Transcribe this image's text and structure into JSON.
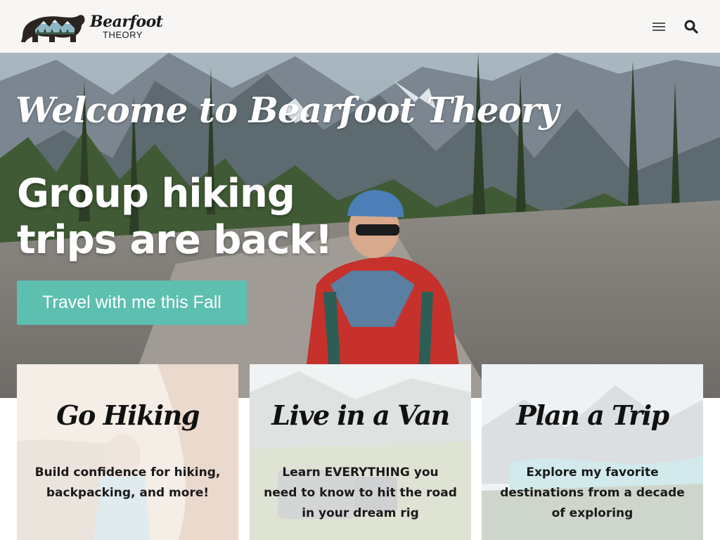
{
  "header": {
    "logo_script": "Bearfoot",
    "logo_sub": "THEORY",
    "menu_icon": "hamburger-menu-icon",
    "search_icon": "search-icon"
  },
  "hero": {
    "welcome": "Welcome to Bearfoot Theory",
    "headline": "Group hiking trips are back!",
    "cta_label": "Travel with me this Fall"
  },
  "cards": [
    {
      "title": "Go Hiking",
      "description": "Build confidence for hiking, backpacking, and more!"
    },
    {
      "title": "Live in a Van",
      "description": "Learn EVERYTHING you need to know to hit the road in your dream rig"
    },
    {
      "title": "Plan a Trip",
      "description": "Explore my favorite destinations from a decade of exploring"
    }
  ],
  "colors": {
    "header_bg": "#f8f6f4",
    "cta_bg": "#5dbfb0",
    "text_dark": "#1a1a1a"
  }
}
